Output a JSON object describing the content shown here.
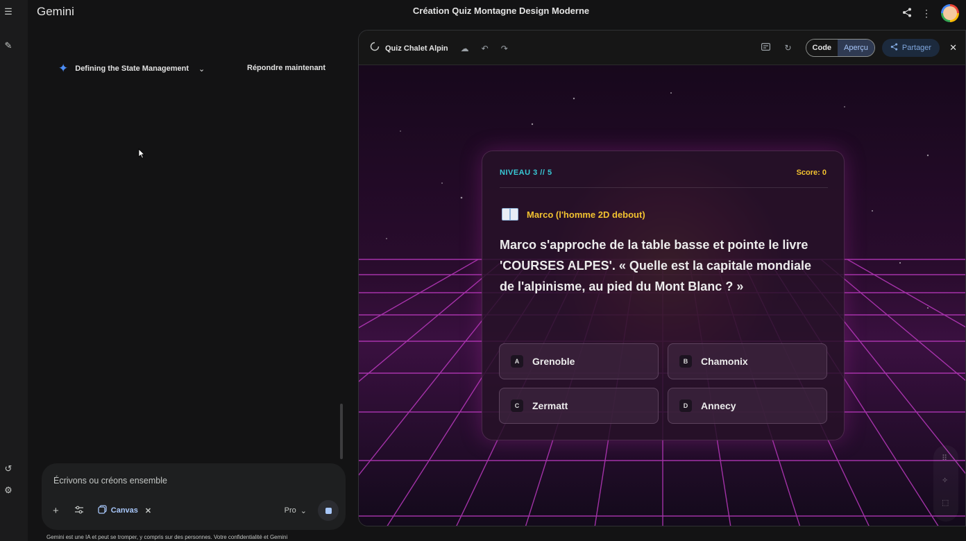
{
  "app": {
    "brand": "Gemini",
    "document_title": "Création Quiz Montagne Design Moderne"
  },
  "rail": {
    "icons": [
      "menu-icon",
      "new-chat-icon",
      "history-icon",
      "settings-icon"
    ]
  },
  "chat": {
    "thinking_label": "Defining the State Management",
    "answer_now_label": "Répondre maintenant"
  },
  "composer": {
    "placeholder": "Écrivons ou créons ensemble",
    "canvas_label": "Canvas",
    "model_label": "Pro",
    "disclaimer": "Gemini est une IA et peut se tromper, y compris sur des personnes. Votre confidentialité et Gemini"
  },
  "canvas_panel": {
    "name": "Quiz Chalet Alpin",
    "code_label": "Code",
    "preview_label": "Aperçu",
    "share_label": "Partager"
  },
  "quiz": {
    "level": "NIVEAU 3 // 5",
    "score": "Score: 0",
    "speaker": "Marco (l'homme 2D debout)",
    "question": "Marco s'approche de la table basse et pointe le livre 'COURSES ALPES'. « Quelle est la capitale mondiale de l'alpinisme, au pied du Mont Blanc ? »",
    "options": [
      {
        "key": "A",
        "label": "Grenoble"
      },
      {
        "key": "B",
        "label": "Chamonix"
      },
      {
        "key": "C",
        "label": "Zermatt"
      },
      {
        "key": "D",
        "label": "Annecy"
      }
    ]
  },
  "colors": {
    "accent_cyan": "#38c9d6",
    "accent_gold": "#f2c230",
    "grid_magenta": "#c43cc8",
    "link_blue": "#a8c7fa"
  }
}
